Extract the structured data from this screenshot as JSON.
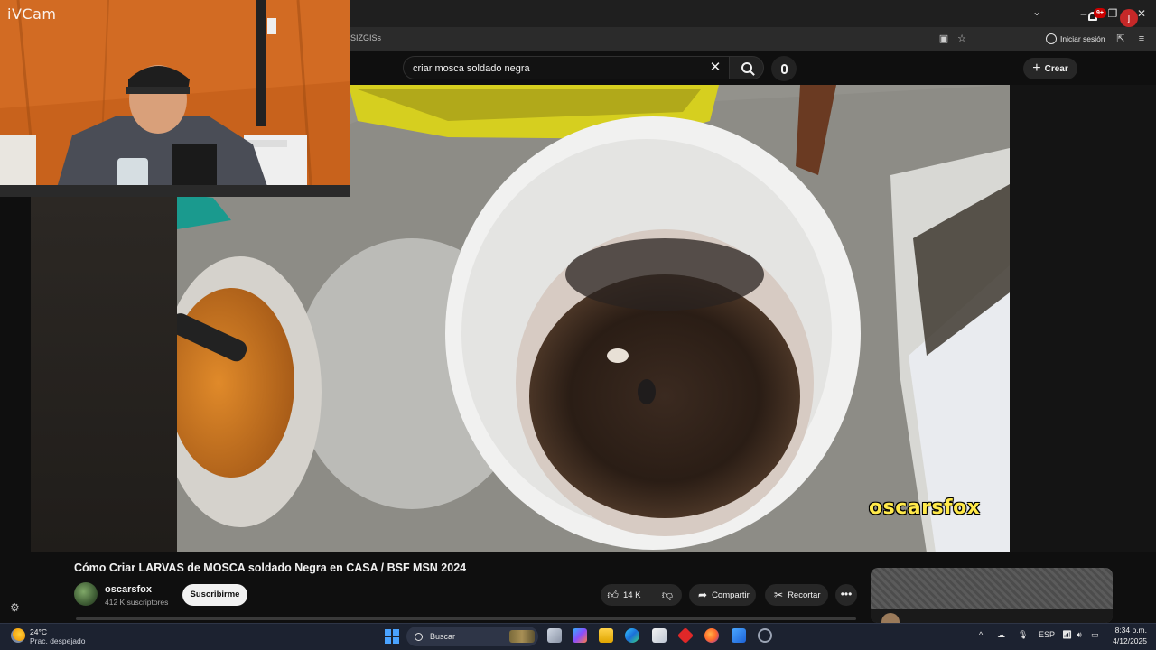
{
  "browser": {
    "address_fragment": "SIZGISs",
    "signin_label": "Iniciar sesión"
  },
  "header": {
    "search_query": "criar mosca soldado negra",
    "create_label": "Crear",
    "notifications_badge": "9+",
    "avatar_letter": "j"
  },
  "webcam": {
    "app_label": "iVCam"
  },
  "video": {
    "watermark": "oscarsfox"
  },
  "watch": {
    "title": "Cómo Criar LARVAS de MOSCA soldado Negra en CASA / BSF MSN 2024",
    "channel_name": "oscarsfox",
    "subscribers": "412 K suscriptores",
    "subscribe_label": "Suscribirme",
    "like_count": "14 K",
    "share_label": "Compartir",
    "clip_label": "Recortar"
  },
  "taskbar": {
    "weather_temp": "24°C",
    "weather_desc": "Prac. despejado",
    "search_label": "Buscar",
    "language": "ESP",
    "time": "8:34 p.m.",
    "date": "4/12/2025"
  },
  "icons": {
    "window_min": "minimize-icon",
    "window_max": "maximize-icon",
    "window_close": "close-icon"
  }
}
